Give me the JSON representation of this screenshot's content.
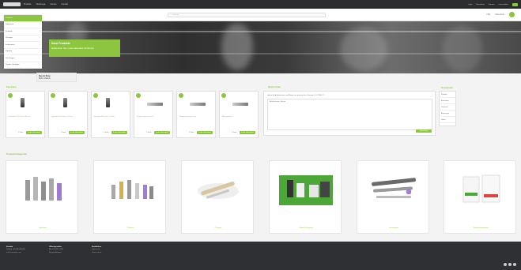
{
  "topbar": {
    "nav": [
      "Produkte",
      "Werkzeuge",
      "Service",
      "Kontakt"
    ],
    "right": [
      "Login",
      "Newsletter",
      "Karriere",
      "Land wählen"
    ]
  },
  "header": {
    "search_placeholder": "Suchen",
    "right": [
      "Hilfe",
      "Warenkorb"
    ]
  },
  "sidemenu": {
    "items": [
      "Produkte",
      "Implantate",
      "Prothetik",
      "Chirurgie",
      "Instrumente",
      "Zubehör",
      "Schulungen",
      "Digitale Lösungen"
    ]
  },
  "hero": {
    "title": "Neue Produkte",
    "subtitle": "Entdecken Sie unser aktuelles Sortiment"
  },
  "newshop": {
    "title": "Neu im Shop",
    "subtitle": "Mehr erfahren"
  },
  "sections": {
    "favorites": "Favoriten",
    "quick_order": "Quick Order",
    "downloads": "Downloads",
    "categories": "Produkt-Kategorien"
  },
  "products": [
    {
      "name": "Implantat Ø 3,5 mm / L 10 mm",
      "qty": "1 Stück",
      "button": "In den Warenkorb"
    },
    {
      "name": "Implantat Ø 4,0 mm / L 11 mm",
      "qty": "1 Stück",
      "button": "In den Warenkorb"
    },
    {
      "name": "Implantat Ø 4,5 mm / L 9 mm",
      "qty": "1 Stück",
      "button": "In den Warenkorb"
    },
    {
      "name": "Eindrehinstrument kurz",
      "qty": "1 Stück",
      "button": "In den Warenkorb"
    },
    {
      "name": "Eindrehinstrument lang",
      "qty": "1 Stück",
      "button": "In den Warenkorb"
    },
    {
      "name": "Abformpfosten",
      "qty": "1 Stück",
      "button": "In den Warenkorb"
    }
  ],
  "quick_order": {
    "hint": "Geben Sie Artikelnummer und Menge ein, getrennt durch Komma (z. B. 12345, 2)",
    "placeholder": "Artikelnummer, Menge",
    "button": "Hinzufügen"
  },
  "downloads": {
    "items": [
      "Kataloge",
      "Broschüren",
      "Preislisten",
      "Anleitungen",
      "Videos"
    ]
  },
  "categories": [
    {
      "caption": "Implantate"
    },
    {
      "caption": "Prothetik"
    },
    {
      "caption": "Chirurgie"
    },
    {
      "caption": "Digitale Lösungen"
    },
    {
      "caption": "Instrumente"
    },
    {
      "caption": "Verbrauchsmaterial"
    }
  ],
  "footer": {
    "col1": {
      "title": "Kontakt",
      "lines": [
        "Telefon +49 000 000000",
        "info@example.com"
      ]
    },
    "col2": {
      "title": "Öffnungszeiten",
      "lines": [
        "Mo–Fr 8:00–17:00",
        "Sa geschlossen"
      ]
    },
    "col3": {
      "title": "Rechtliches",
      "lines": [
        "Impressum",
        "Datenschutz"
      ]
    }
  },
  "colors": {
    "accent": "#8cc63f",
    "topbar": "#2b2d2f",
    "footer": "#2e3033"
  }
}
